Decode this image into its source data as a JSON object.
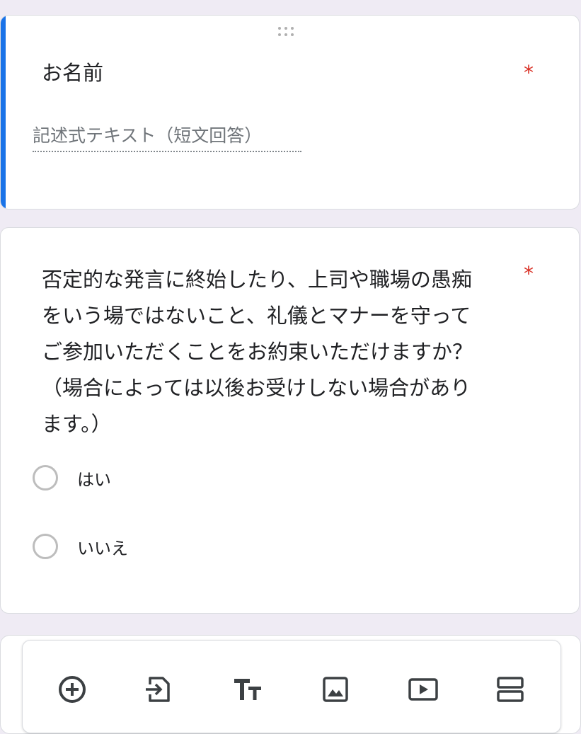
{
  "questions": [
    {
      "title": "お名前",
      "required_mark": "*",
      "input_placeholder": "記述式テキスト（短文回答）"
    },
    {
      "title": "否定的な発言に終始したり、上司や職場の愚痴\nをいう場ではないこと、礼儀とマナーを守って\nご参加いただくことをお約束いただけますか？\n（場合によっては以後お受けしない場合があり\nます。）",
      "required_mark": "*",
      "options": [
        {
          "label": "はい"
        },
        {
          "label": "いいえ"
        }
      ]
    }
  ],
  "toolbar": {
    "items": [
      {
        "icon": "add-circle-icon"
      },
      {
        "icon": "import-questions-icon"
      },
      {
        "icon": "title-text-icon"
      },
      {
        "icon": "image-icon"
      },
      {
        "icon": "video-icon"
      },
      {
        "icon": "section-icon"
      }
    ]
  },
  "colors": {
    "accent": "#1a73e8",
    "required": "#d93025",
    "background": "#efebf4",
    "icon": "#3c4043"
  }
}
